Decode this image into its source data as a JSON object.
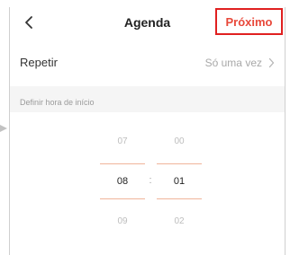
{
  "header": {
    "back_icon": "chevron-left-icon",
    "title": "Agenda",
    "next_label": "Próximo"
  },
  "colors": {
    "accent": "#e8483a",
    "highlight_border": "#e02020",
    "selection_line": "#f0b49a",
    "background": "#f5f5f5"
  },
  "repeat": {
    "label": "Repetir",
    "value": "Só uma vez",
    "chevron_icon": "chevron-right-icon"
  },
  "start_time": {
    "section_label": "Definir hora de início",
    "hours": {
      "prev": "07",
      "selected": "08",
      "next": "09"
    },
    "separator": ":",
    "minutes": {
      "prev": "00",
      "selected": "01",
      "next": "02"
    }
  }
}
